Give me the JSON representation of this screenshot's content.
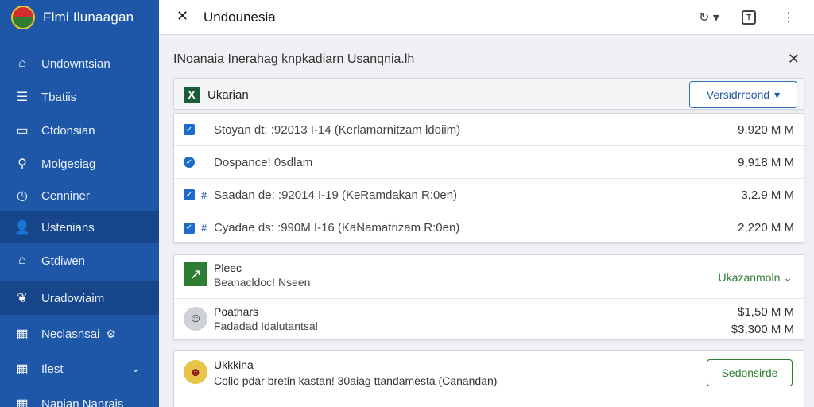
{
  "app": {
    "title": "Flmi Ilunaagan"
  },
  "sidebar": {
    "items": [
      {
        "icon": "home-icon",
        "glyph": "⌂",
        "label": "Undowntsian"
      },
      {
        "icon": "list-icon",
        "glyph": "☰",
        "label": "Tbatiis"
      },
      {
        "icon": "window-icon",
        "glyph": "▭",
        "label": "Ctdonsian"
      },
      {
        "icon": "search-icon",
        "glyph": "⚲",
        "label": "Molgesiag"
      },
      {
        "icon": "clock-icon",
        "glyph": "◷",
        "label": "Cenniner"
      },
      {
        "icon": "user-icon",
        "glyph": "👤",
        "label": "Ustenians"
      },
      {
        "icon": "lock-icon",
        "glyph": "⌂",
        "label": "Gtdiwen"
      },
      {
        "icon": "bird-icon",
        "glyph": "❦",
        "label": "Uradowiaim"
      },
      {
        "icon": "grid-icon",
        "glyph": "▦",
        "label": "Neclasnsai",
        "trail": "⚙"
      },
      {
        "icon": "grid-icon",
        "glyph": "▦",
        "label": "Ilest",
        "chevron": "⌄"
      },
      {
        "icon": "grid-icon",
        "glyph": "▦",
        "label": "Napian Nanrais"
      }
    ]
  },
  "topbar": {
    "back_glyph": "✕",
    "title": "Undounesia",
    "history_glyph": "↻ ▾",
    "box_letter": "T",
    "more_glyph": "⋮"
  },
  "panel": {
    "title": "INoanaia Inerahag knpkadiarn Usanqnia.lh",
    "close_glyph": "✕",
    "header": {
      "logo_letter": "X",
      "label": "Ukarian",
      "button_label": "Versidrrbond",
      "button_caret": "▾"
    },
    "rows": [
      {
        "text": "Stoyan dt:  :92013  I-14   (Kerlamarnitzam ldoiim)",
        "value": "9,920 M M",
        "check": "✓",
        "hash": ""
      },
      {
        "text": "Dospance! 0sdlam",
        "value": "9,918 M M",
        "check": "✓",
        "hash": ""
      },
      {
        "text": "Saadan de:  :92014  I-19   (KeRamdakan R:0en)",
        "value": "3,2.9 M M",
        "check": "✓",
        "hash": "#"
      },
      {
        "text": "Cyadae ds:  :990M  I-16   (KaNamatrizam R:0en)",
        "value": "2,220 M M",
        "check": "✓",
        "hash": "#"
      }
    ],
    "accounts": [
      {
        "title": "Pleec",
        "subtitle": "Beanacldoc! Nseen",
        "link": "Ukazanmoln",
        "link_caret": "⌄"
      },
      {
        "title": "Poathars",
        "subtitle": "Fadadad Idalutantsal",
        "value1": "$1,50 M M",
        "value2": "$3,300 M M"
      }
    ],
    "bottom": {
      "title": "Ukkkina",
      "subtitle": "Colio pdar bretin kastan! 30aiag ttandamesta (Canandan)",
      "button_label": "Sedonsirde"
    }
  },
  "colors": {
    "sidebar": "#1e57a8",
    "accent_blue": "#1e6cc8",
    "accent_green": "#2e7d32"
  }
}
